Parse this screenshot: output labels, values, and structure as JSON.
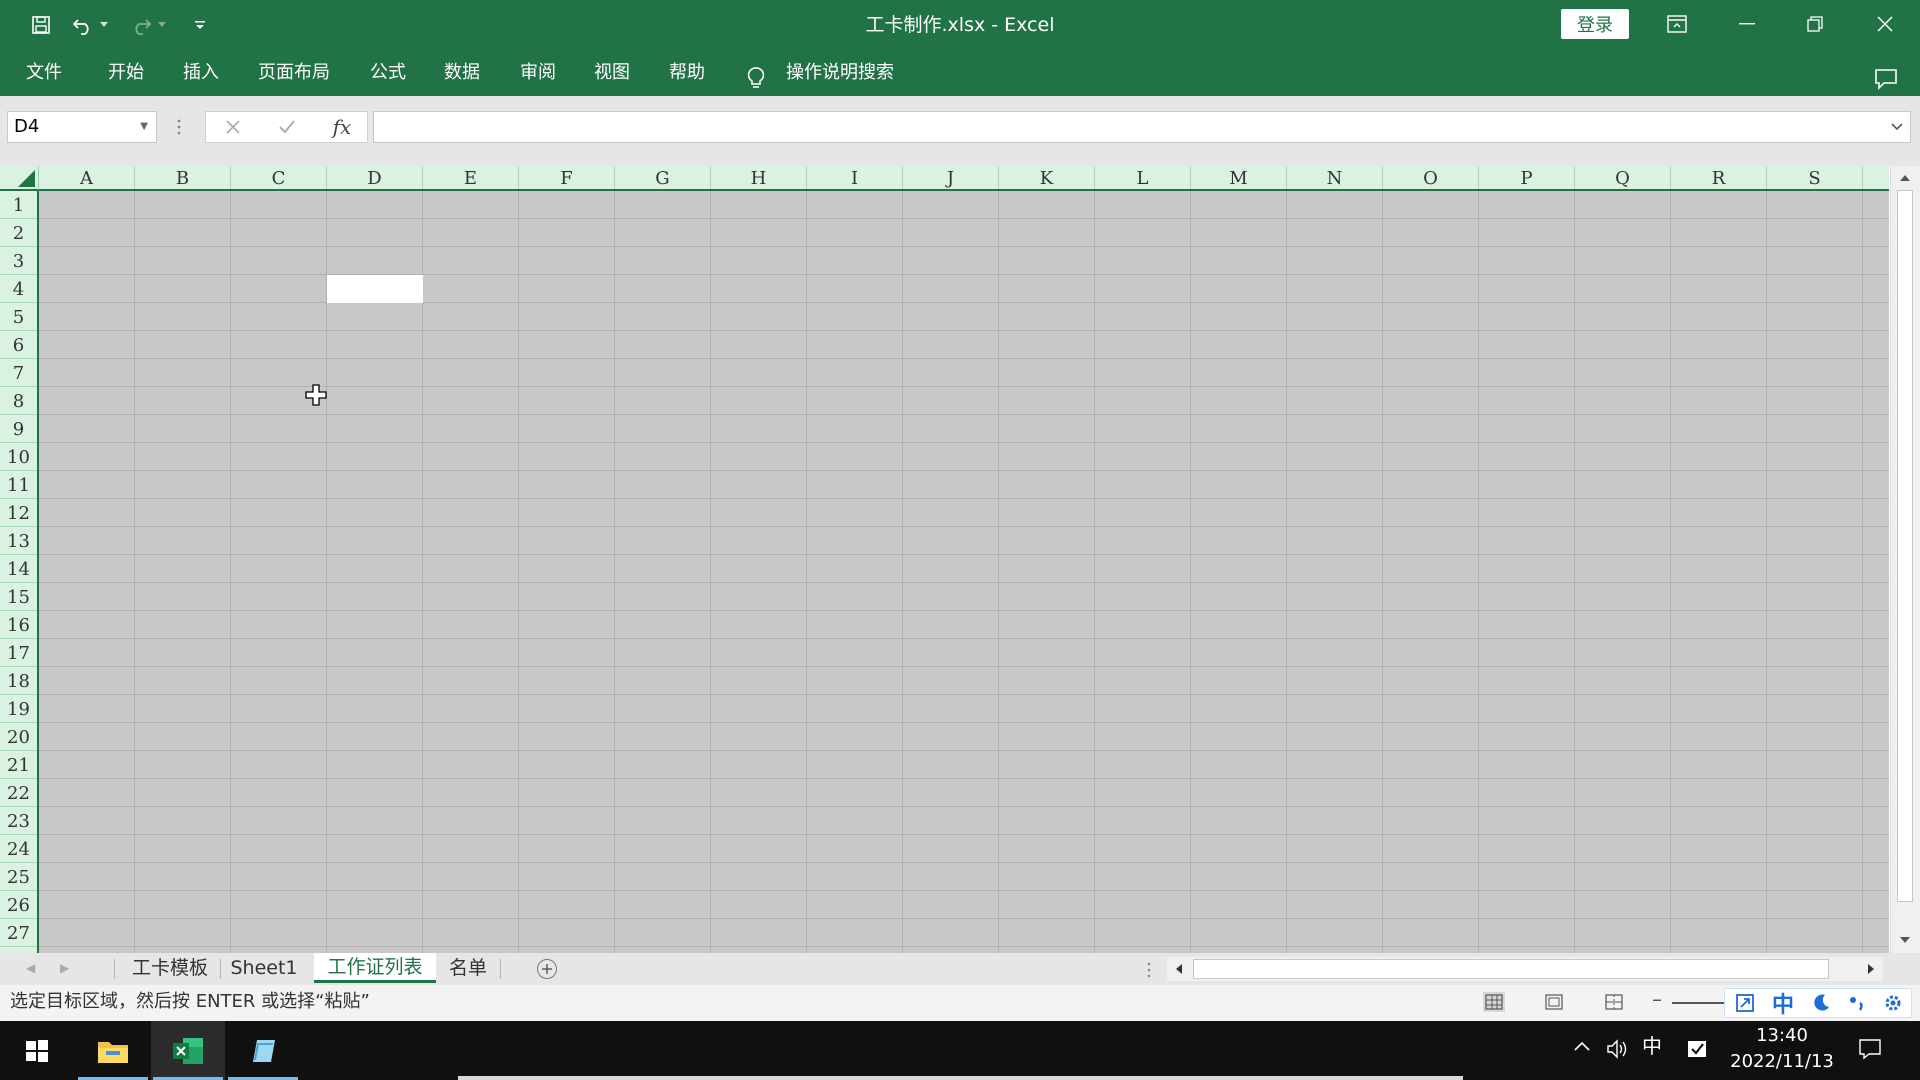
{
  "window": {
    "title": "工卡制作.xlsx  -  Excel",
    "signin_label": "登录"
  },
  "ribbon": {
    "tabs": [
      "文件",
      "开始",
      "插入",
      "页面布局",
      "公式",
      "数据",
      "审阅",
      "视图",
      "帮助"
    ],
    "tell_me": "操作说明搜索"
  },
  "formula_bar": {
    "name_box": "D4",
    "fx_label": "fx",
    "formula": ""
  },
  "grid": {
    "columns": [
      "A",
      "B",
      "C",
      "D",
      "E",
      "F",
      "G",
      "H",
      "I",
      "J",
      "K",
      "L",
      "M",
      "N",
      "O",
      "P",
      "Q",
      "R",
      "S"
    ],
    "rows": [
      "1",
      "2",
      "3",
      "4",
      "5",
      "6",
      "7",
      "8",
      "9",
      "10",
      "11",
      "12",
      "13",
      "14",
      "15",
      "16",
      "17",
      "18",
      "19",
      "20",
      "21",
      "22",
      "23",
      "24",
      "25",
      "26",
      "27"
    ],
    "selected_cell": "D4"
  },
  "sheets": {
    "tabs": [
      "工卡模板",
      "Sheet1",
      "工作证列表",
      "名单"
    ],
    "active": "工作证列表"
  },
  "status": {
    "text": "选定目标区域，然后按 ENTER 或选择“粘贴”"
  },
  "ime": {
    "mode": "中"
  },
  "taskbar": {
    "time": "13:40",
    "date": "2022/11/13",
    "ime": "中"
  },
  "colors": {
    "excel_green": "#217346",
    "header_bg": "#d9f2e2",
    "dim_cells": "#c8c8c8"
  }
}
